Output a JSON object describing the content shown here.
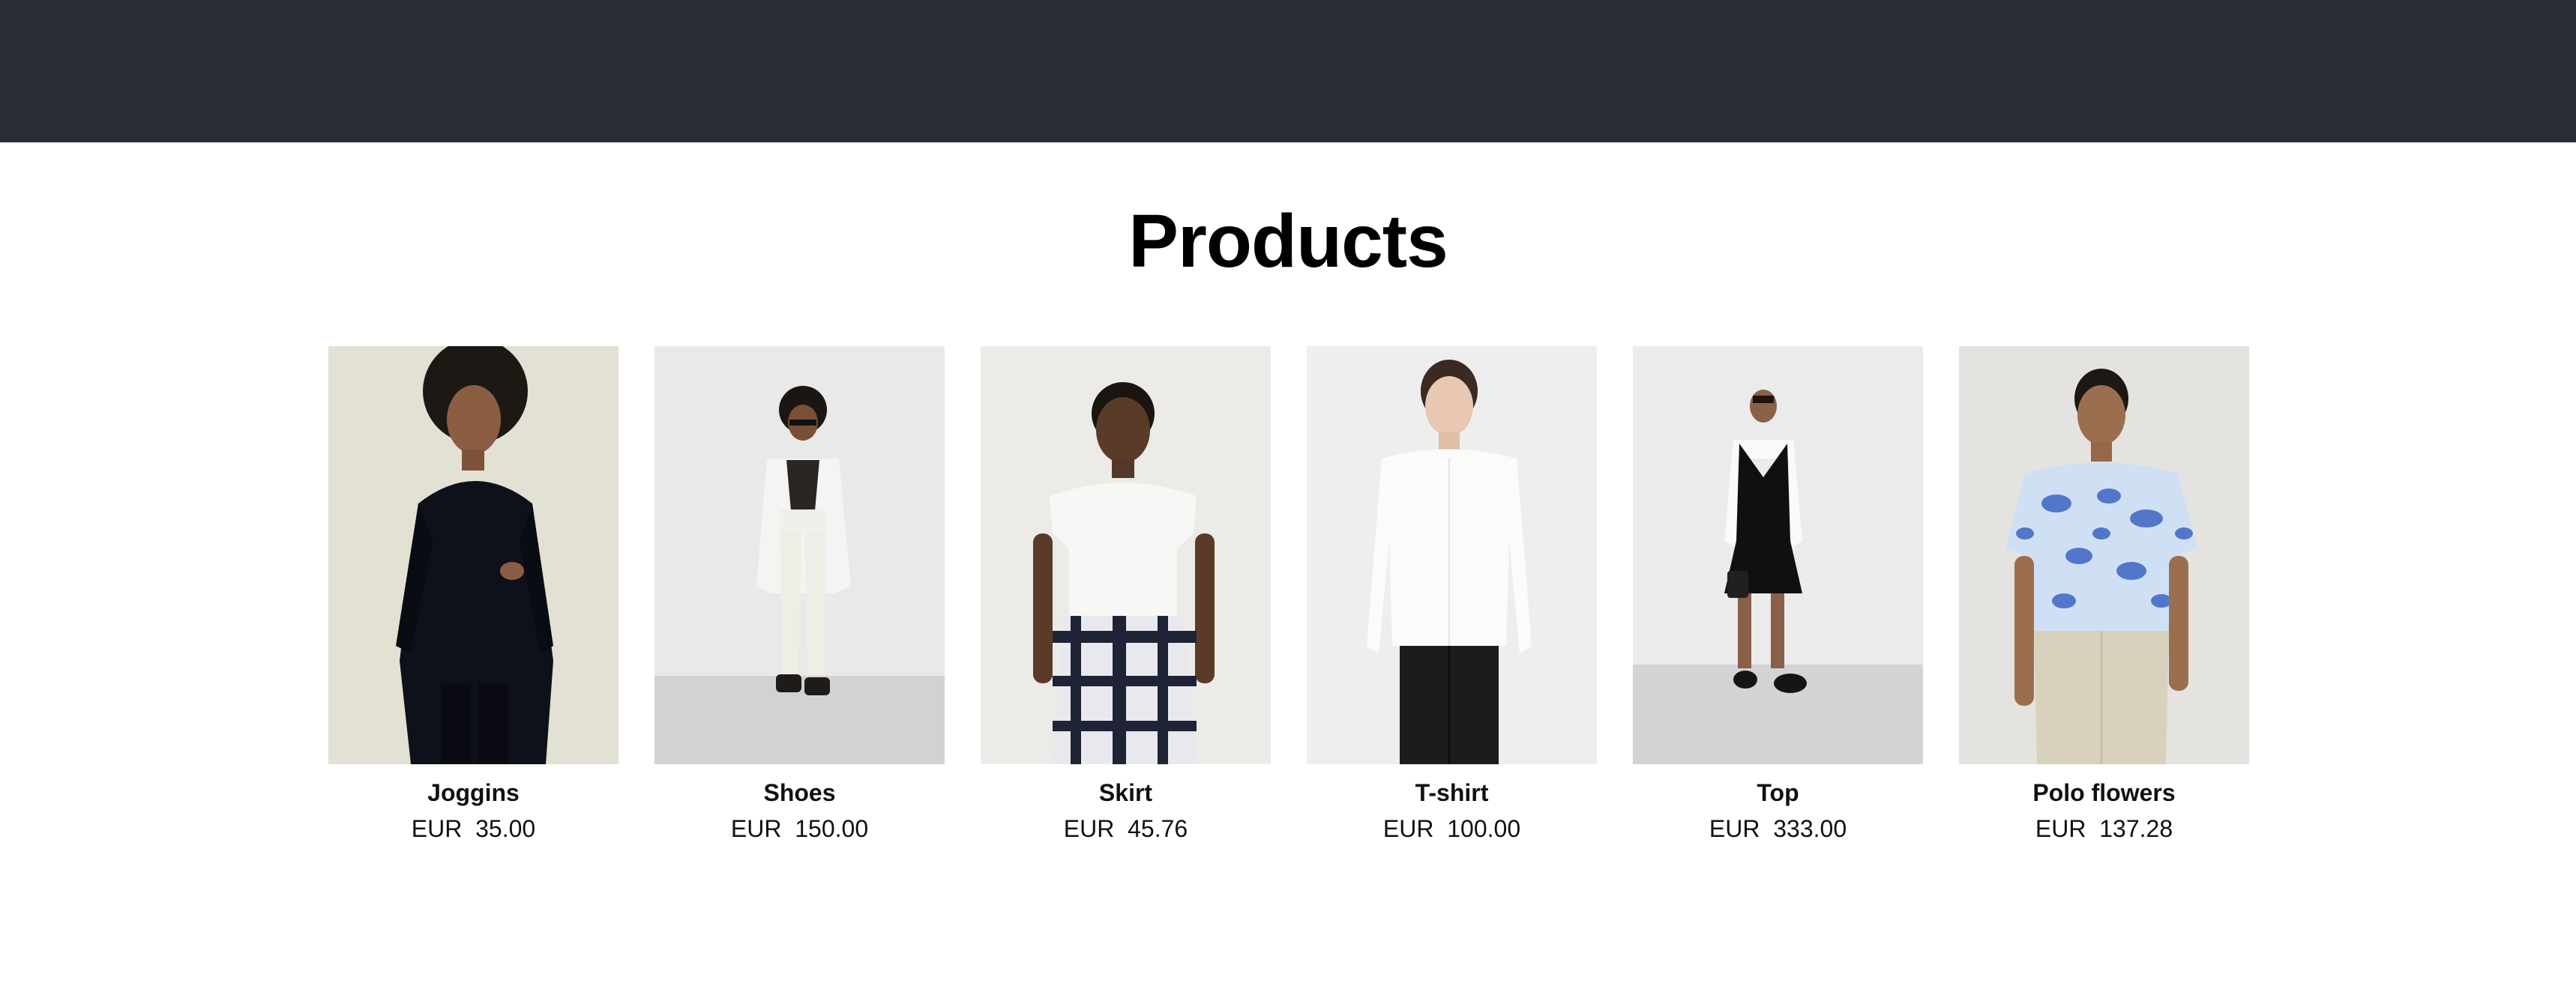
{
  "page": {
    "title": "Products",
    "header_color": "#282c34"
  },
  "products": [
    {
      "name": "Joggins",
      "currency": "EUR",
      "price": "35.00",
      "image_icon": "model-black-hoodie-image"
    },
    {
      "name": "Shoes",
      "currency": "EUR",
      "price": "150.00",
      "image_icon": "model-white-outfit-sandals-image"
    },
    {
      "name": "Skirt",
      "currency": "EUR",
      "price": "45.76",
      "image_icon": "model-plaid-skirt-image"
    },
    {
      "name": "T-shirt",
      "currency": "EUR",
      "price": "100.00",
      "image_icon": "model-white-shirt-image"
    },
    {
      "name": "Top",
      "currency": "EUR",
      "price": "333.00",
      "image_icon": "model-black-pinafore-image"
    },
    {
      "name": "Polo flowers",
      "currency": "EUR",
      "price": "137.28",
      "image_icon": "model-floral-shirt-image"
    }
  ]
}
